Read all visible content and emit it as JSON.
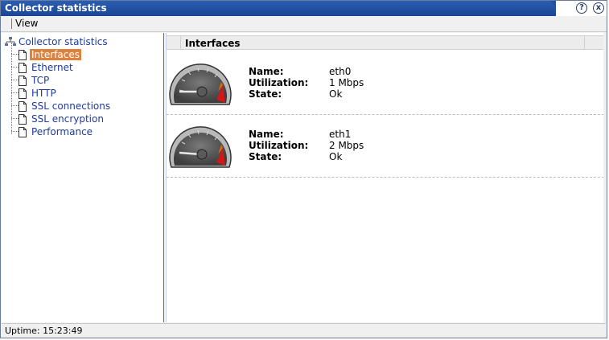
{
  "window": {
    "title": "Collector statistics"
  },
  "titlebar_buttons": {
    "help": "?",
    "close": "x"
  },
  "menu": {
    "view": "View"
  },
  "tree": {
    "root": "Collector statistics",
    "items": [
      {
        "label": "Interfaces",
        "selected": true
      },
      {
        "label": "Ethernet",
        "selected": false
      },
      {
        "label": "TCP",
        "selected": false
      },
      {
        "label": "HTTP",
        "selected": false
      },
      {
        "label": "SSL connections",
        "selected": false
      },
      {
        "label": "SSL encryption",
        "selected": false
      },
      {
        "label": "Performance",
        "selected": false
      }
    ]
  },
  "panel": {
    "title": "Interfaces",
    "labels": {
      "name": "Name:",
      "utilization": "Utilization:",
      "state": "State:"
    },
    "interfaces": [
      {
        "name": "eth0",
        "utilization": "1 Mbps",
        "state": "Ok"
      },
      {
        "name": "eth1",
        "utilization": "2 Mbps",
        "state": "Ok"
      }
    ]
  },
  "status": {
    "uptime": "Uptime: 15:23:49"
  },
  "colors": {
    "title_bg": "#1f4f9e",
    "selection": "#e0813b",
    "link": "#1e3b9e",
    "gauge_red": "#d01818"
  }
}
